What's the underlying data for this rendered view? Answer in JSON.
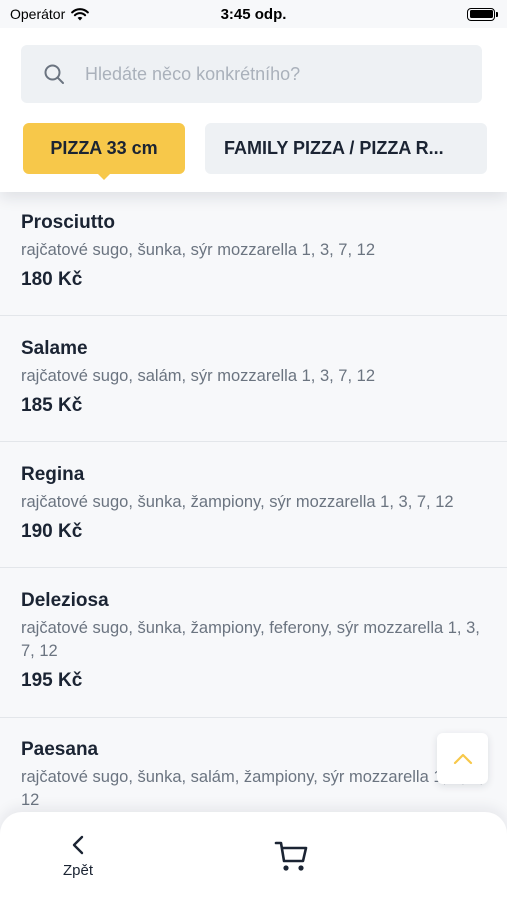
{
  "status_bar": {
    "carrier": "Operátor",
    "time": "3:45 odp."
  },
  "search": {
    "placeholder": "Hledáte něco konkrétního?"
  },
  "tabs": [
    {
      "label": "PIZZA 33 cm",
      "active": true
    },
    {
      "label": "FAMILY PIZZA / PIZZA R...",
      "active": false
    }
  ],
  "items": [
    {
      "name": "Prosciutto",
      "description": "rajčatové sugo, šunka, sýr mozzarella 1, 3, 7, 12",
      "price": "180 Kč"
    },
    {
      "name": "Salame",
      "description": "rajčatové sugo, salám, sýr mozzarella 1, 3, 7, 12",
      "price": "185 Kč"
    },
    {
      "name": "Regina",
      "description": "rajčatové sugo, šunka, žampiony, sýr mozzarella 1, 3, 7, 12",
      "price": "190 Kč"
    },
    {
      "name": "Deleziosa",
      "description": "rajčatové sugo, šunka, žampiony, feferony, sýr mozzarella 1, 3, 7, 12",
      "price": "195 Kč"
    },
    {
      "name": "Paesana",
      "description": "rajčatové sugo, šunka, salám, žampiony, sýr mozzarella 1, 3, 7, 12",
      "price": ""
    }
  ],
  "bottom_bar": {
    "back_label": "Zpět"
  },
  "colors": {
    "accent": "#f7c84a",
    "text_dark": "#1b2433",
    "text_muted": "#6b7480"
  }
}
